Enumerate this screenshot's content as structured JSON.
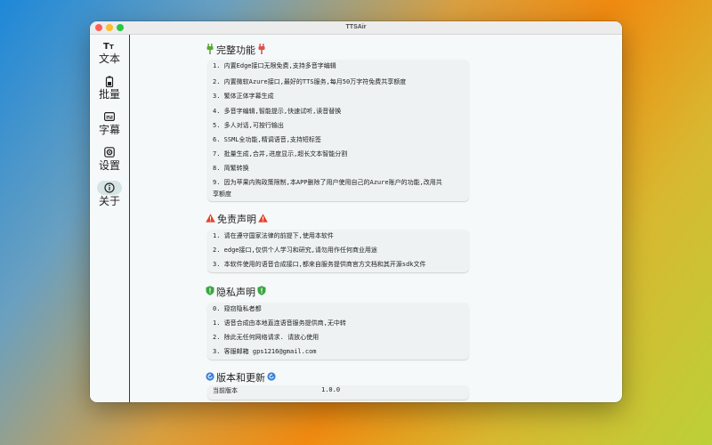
{
  "window": {
    "title": "TTSAir"
  },
  "sidebar": {
    "items": [
      {
        "label": "文本",
        "icon": "text-size-icon"
      },
      {
        "label": "批量",
        "icon": "battery-icon"
      },
      {
        "label": "字幕",
        "icon": "subtitles-icon"
      },
      {
        "label": "设置",
        "icon": "gear-icon"
      },
      {
        "label": "关于",
        "icon": "info-icon",
        "active": true
      }
    ]
  },
  "features": {
    "title": "完整功能",
    "items": [
      "1. 内置Edge接口无限免费,支持多音字编辑",
      "2. 内置微软Azure接口,最好的TTS服务,每月50万字符免费共享额度",
      "3. 繁体正体字幕生成",
      "4. 多音字编辑,智能提示,快速试听,读音替换",
      "5. 多人对话,可按行输出",
      "6. SSML全功能,精调语音,支持短标签",
      "7. 批量生成,合并,进度显示,超长文本智能分割",
      "8. 简繁转换",
      "9. 因为苹果内购政策限制,本APP删除了用户使用自己的Azure账户的功能,改用共享额度"
    ]
  },
  "disclaimer": {
    "title": "免责声明",
    "items": [
      "1. 请在遵守国家法律的前提下,使用本软件",
      "2. edge接口,仅供个人学习和研究,请勿用作任何商业用途",
      "3. 本软件使用的语音合成接口,都来自服务提供商官方文档和其开源sdk文件"
    ]
  },
  "privacy": {
    "title": "隐私声明",
    "items": [
      "0. 窥窃隐私者都",
      "1. 语音合成由本地直连语音服务提供商,无中转",
      "2. 除此无任何网络请求. 请放心使用",
      "3. 客服邮箱 gps1216@gmail.com"
    ]
  },
  "version": {
    "title": "版本和更新",
    "label": "当前版本",
    "value": "1.0.0"
  }
}
